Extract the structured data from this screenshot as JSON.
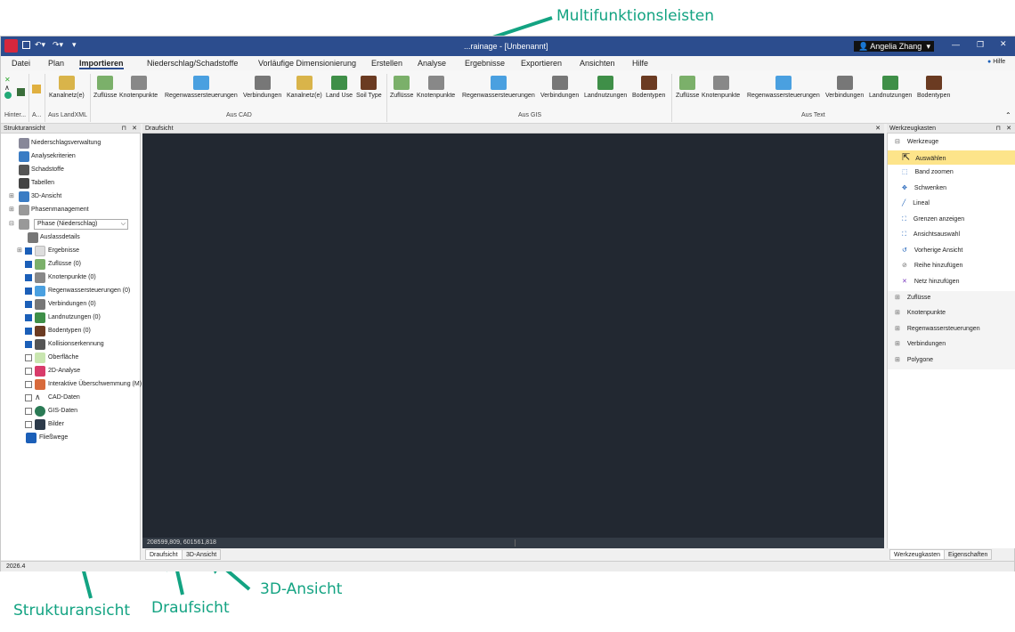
{
  "annotations": {
    "multi": "Multifunktionsleisten",
    "struktur": "Strukturansicht",
    "drauf": "Draufsicht",
    "drei": "3D-Ansicht"
  },
  "title": {
    "app": "...rainage - [Unbenannt]",
    "user": "Angelia Zhang"
  },
  "menu": [
    "Datei",
    "Plan",
    "Importieren",
    "Niederschlag/Schadstoffe",
    "Vorläufige Dimensionierung",
    "Erstellen",
    "Analyse",
    "Ergebnisse",
    "Exportieren",
    "Ansichten",
    "Hilfe"
  ],
  "help": "Hilfe",
  "ribbon": {
    "buttons": [
      "Kanalnetz(e)",
      "Zuflüsse",
      "Knotenpunkte",
      "Regenwassersteuerungen",
      "Verbindungen",
      "Kanalnetz(e)",
      "Land Use",
      "Soil Type",
      "Zuflüsse",
      "Knotenpunkte",
      "Regenwassersteuerungen",
      "Verbindungen",
      "Landnutzungen",
      "Bodentypen",
      "Zuflüsse",
      "Knotenpunkte",
      "Regenwassersteuerungen",
      "Verbindungen",
      "Landnutzungen",
      "Bodentypen"
    ],
    "groups": [
      "Hinter...",
      "A...",
      "Aus LandXML",
      "Aus CAD",
      "Aus GIS",
      "Aus Text"
    ]
  },
  "left": {
    "title": "Strukturansicht",
    "phase": "Phase (Niederschlag)",
    "items": [
      "Niederschlagsverwaltung",
      "Analysekriterien",
      "Schadstoffe",
      "Tabellen",
      "3D-Ansicht",
      "Phasenmanagement",
      "Auslassdetails",
      "Ergebnisse",
      "Zuflüsse (0)",
      "Knotenpunkte (0)",
      "Regenwassersteuerungen (0)",
      "Verbindungen (0)",
      "Landnutzungen (0)",
      "Bodentypen (0)",
      "Kollisionserkennung",
      "Oberfläche",
      "2D-Analyse",
      "Interaktive Überschwemmung (M)",
      "CAD-Daten",
      "GIS-Daten",
      "Bilder",
      "Fließwege"
    ]
  },
  "center": {
    "title": "Draufsicht",
    "coords": "208599,809, 601561,818",
    "tabs": [
      "Draufsicht",
      "3D-Ansicht"
    ]
  },
  "right": {
    "title": "Werkzeugkasten",
    "group": "Werkzeuge",
    "tools": [
      "Auswählen",
      "Band zoomen",
      "Schwenken",
      "Lineal",
      "Grenzen anzeigen",
      "Ansichtsauswahl",
      "Vorherige Ansicht",
      "Reihe hinzufügen",
      "Netz hinzufügen"
    ],
    "sections": [
      "Zuflüsse",
      "Knotenpunkte",
      "Regenwassersteuerungen",
      "Verbindungen",
      "Polygone"
    ],
    "tabs": [
      "Werkzeugkasten",
      "Eigenschaften"
    ]
  },
  "status": "2026.4"
}
